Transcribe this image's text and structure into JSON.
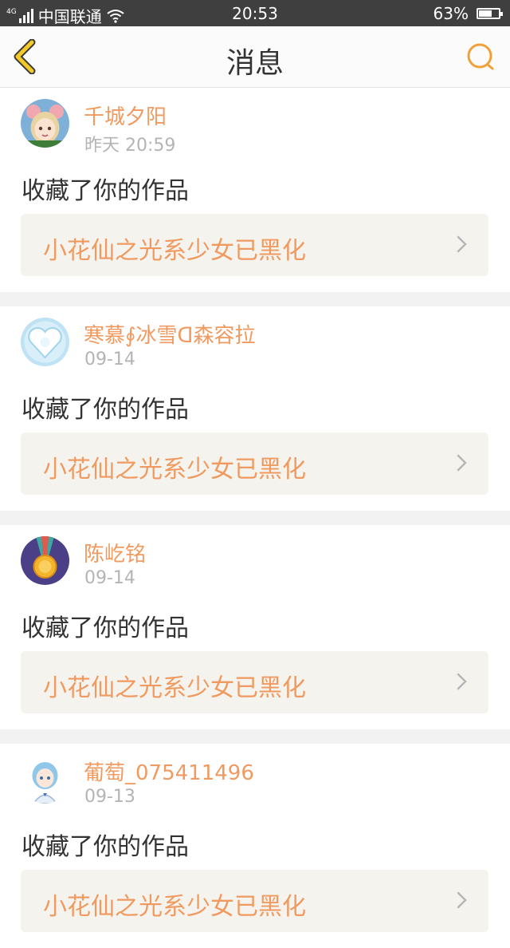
{
  "status_bar": {
    "network": "4G",
    "carrier": "中国联通",
    "time": "20:53",
    "battery": "63%",
    "battery_level": 0.63
  },
  "nav": {
    "title": "消息",
    "back_icon": "chevron-left-icon",
    "search_icon": "search-icon",
    "accent": "#f0a13a"
  },
  "colors": {
    "name": "#f09a60",
    "date": "#b4b4b4",
    "action": "#333333",
    "work_bg": "#f4f3ee"
  },
  "notifications": [
    {
      "user": "千城夕阳",
      "time": "昨天 20:59",
      "action": "收藏了你的作品",
      "work": "小花仙之光系少女已黑化",
      "avatar_icon": "anime-girl-avatar"
    },
    {
      "user": "寒慕∮冰雪ᗡ森容拉",
      "time": "09-14",
      "action": "收藏了你的作品",
      "work": "小花仙之光系少女已黑化",
      "avatar_icon": "ice-heart-avatar"
    },
    {
      "user": "陈屹铭",
      "time": "09-14",
      "action": "收藏了你的作品",
      "work": "小花仙之光系少女已黑化",
      "avatar_icon": "medal-avatar"
    },
    {
      "user": "葡萄_075411496",
      "time": "09-13",
      "action": "收藏了你的作品",
      "work": "小花仙之光系少女已黑化",
      "avatar_icon": "anime-character-avatar"
    }
  ]
}
